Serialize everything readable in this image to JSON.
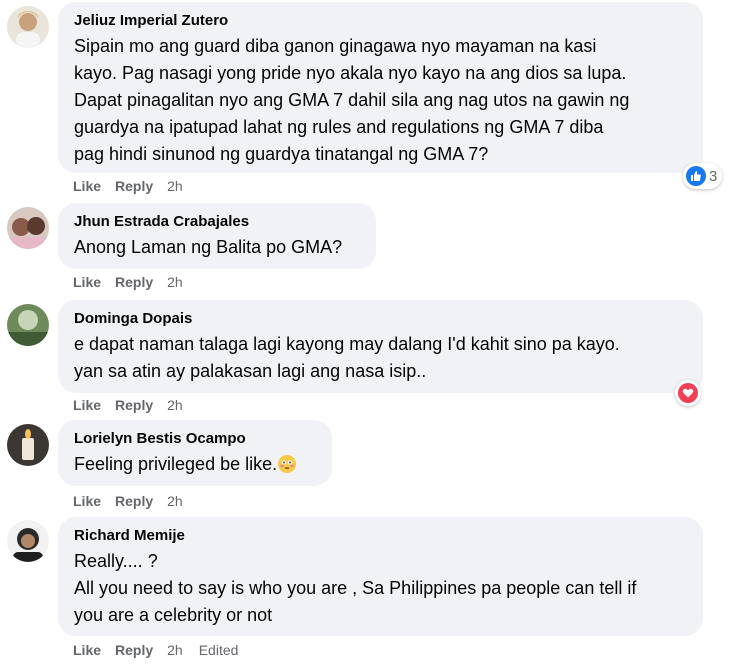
{
  "colors": {
    "bubble": "#f0f2f5",
    "meta_text": "#65676b",
    "like_blue": "#1877f2",
    "love_red": "#f33e58"
  },
  "comments": [
    {
      "author": "Jeliuz Imperial Zutero",
      "text": "Sipain mo ang guard diba ganon ginagawa nyo mayaman na kasi\nkayo. Pag nasagi yong pride nyo akala nyo kayo na ang dios sa lupa.\nDapat pinagalitan nyo ang GMA 7 dahil sila ang nag utos na gawin ng\nguardya na ipatupad lahat ng rules and regulations ng GMA 7 diba\npag hindi sinunod ng guardya tinatangal ng GMA 7?",
      "like": "Like",
      "reply": "Reply",
      "time": "2h",
      "reaction": {
        "icon": "like-icon",
        "count": "3"
      }
    },
    {
      "author": "Jhun Estrada Crabajales",
      "text": "Anong Laman ng Balita po GMA?",
      "like": "Like",
      "reply": "Reply",
      "time": "2h"
    },
    {
      "author": "Dominga Dopais",
      "text": "e dapat naman talaga lagi kayong may dalang I'd kahit sino pa kayo.\nyan sa atin ay palakasan lagi ang nasa isip..",
      "like": "Like",
      "reply": "Reply",
      "time": "2h",
      "reaction": {
        "icon": "love-icon",
        "count": ""
      }
    },
    {
      "author": "Lorielyn Bestis Ocampo",
      "text": "Feeling privileged be like.",
      "emoji": "flushed-face-emoji",
      "like": "Like",
      "reply": "Reply",
      "time": "2h"
    },
    {
      "author": "Richard Memije",
      "text": "Really.... ?\nAll you need to say is who you are , Sa Philippines pa people can tell if\nyou are a celebrity or not",
      "like": "Like",
      "reply": "Reply",
      "time": "2h",
      "edited": "Edited"
    }
  ]
}
